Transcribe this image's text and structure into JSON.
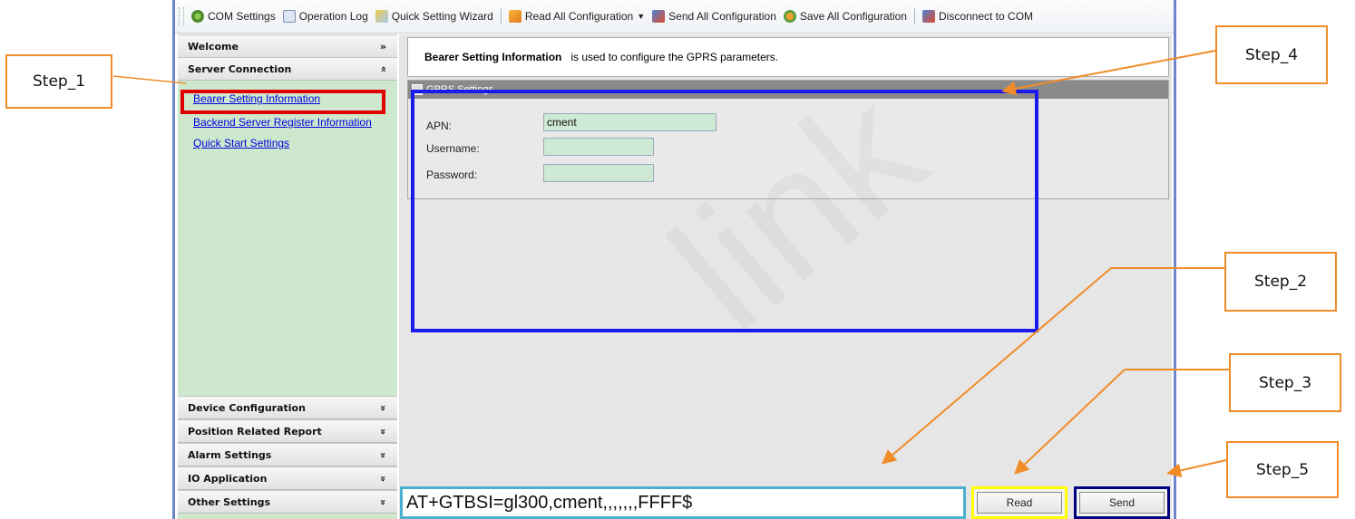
{
  "toolbar": {
    "items": [
      {
        "label": "COM Settings",
        "icon": "gear-icon"
      },
      {
        "label": "Operation Log",
        "icon": "log-icon"
      },
      {
        "label": "Quick Setting Wizard",
        "icon": "wizard-icon"
      },
      {
        "label": "Read All Configuration",
        "icon": "read-icon"
      },
      {
        "label": "Send All Configuration",
        "icon": "send-icon"
      },
      {
        "label": "Save All Configuration",
        "icon": "save-icon"
      },
      {
        "label": "Disconnect to COM",
        "icon": "disconnect-icon"
      }
    ]
  },
  "sidebar": {
    "sections": {
      "welcome": "Welcome",
      "server_connection": "Server Connection",
      "device_configuration": "Device Configuration",
      "position_related_report": "Position Related Report",
      "alarm_settings": "Alarm Settings",
      "io_application": "IO Application",
      "other_settings": "Other Settings"
    },
    "server_links": [
      "Bearer Setting Information",
      "Backend Server Register Information",
      "Quick Start Settings"
    ]
  },
  "main": {
    "info_title": "Bearer Setting Information",
    "info_desc": "is used to configure the GPRS parameters.",
    "gprs_header": "GPRS Settings",
    "apn_label": "APN:",
    "apn_value": "cment",
    "username_label": "Username:",
    "username_value": "",
    "password_label": "Password:",
    "password_value": ""
  },
  "command": {
    "text": "AT+GTBSI=gl300,cment,,,,,,,FFFF$",
    "read_label": "Read",
    "send_label": "Send"
  },
  "annotations": {
    "step1": "Step_1",
    "step2": "Step_2",
    "step3": "Step_3",
    "step4": "Step_4",
    "step5": "Step_5"
  },
  "colors": {
    "sidebar_bg": "#cde8cd",
    "annotation_orange": "#f08c28",
    "highlight_red": "#e00000",
    "highlight_blue": "#1a1aee",
    "highlight_cyan": "#4ab0d0",
    "highlight_yellow": "#ffff00",
    "highlight_navy": "#000080"
  }
}
